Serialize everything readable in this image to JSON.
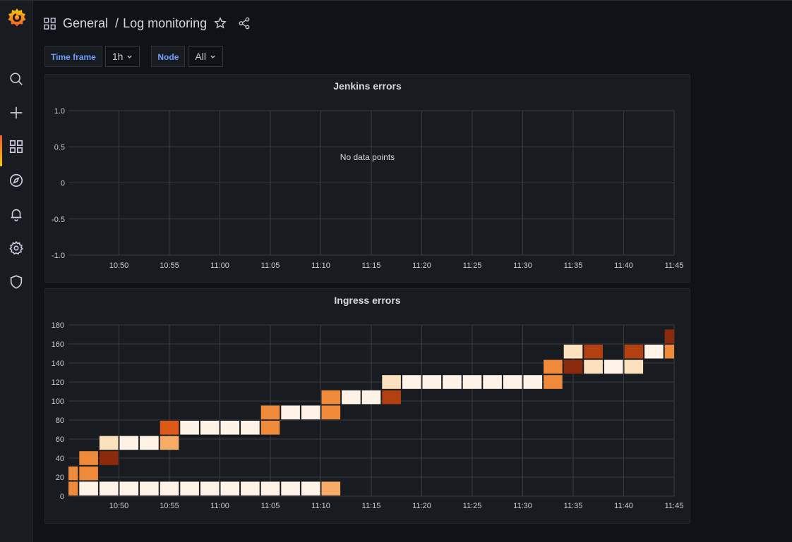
{
  "breadcrumb": {
    "folder": "General",
    "separator": "/",
    "dashboard": "Log monitoring"
  },
  "variables": [
    {
      "label": "Time frame",
      "value": "1h"
    },
    {
      "label": "Node",
      "value": "All"
    }
  ],
  "icons": [
    "grafana-logo-icon",
    "search-icon",
    "plus-icon",
    "dashboards-icon",
    "explore-icon",
    "alerting-icon",
    "settings-icon",
    "shield-icon",
    "star-icon",
    "share-icon",
    "chevron-down-icon"
  ],
  "colors": {
    "background": "#111217",
    "panel": "#181b1f",
    "accent": "#6e9fff",
    "brand": "#f05a28"
  },
  "panels": {
    "jenkins": {
      "title": "Jenkins errors",
      "no_data": "No data points"
    },
    "ingress": {
      "title": "Ingress errors"
    }
  },
  "chart_data": [
    {
      "type": "line",
      "title": "Jenkins errors",
      "x_ticks": [
        "10:50",
        "10:55",
        "11:00",
        "11:05",
        "11:10",
        "11:15",
        "11:20",
        "11:25",
        "11:30",
        "11:35",
        "11:40",
        "11:45"
      ],
      "y_ticks": [
        "1.0",
        "0.5",
        "0",
        "-0.5",
        "-1.0"
      ],
      "ylim": [
        -1,
        1
      ],
      "series": [],
      "grid": true
    },
    {
      "type": "heatmap",
      "title": "Ingress errors",
      "x_ticks": [
        "10:50",
        "10:55",
        "11:00",
        "11:05",
        "11:10",
        "11:15",
        "11:20",
        "11:25",
        "11:30",
        "11:35",
        "11:40",
        "11:45"
      ],
      "y_ticks": [
        "0",
        "20",
        "40",
        "60",
        "80",
        "100",
        "120",
        "140",
        "160",
        "180"
      ],
      "ylim": [
        0,
        180
      ],
      "xlim": [
        "10:45",
        "11:45"
      ],
      "bucket_minutes": 2,
      "bucket_size": 16,
      "grid": true,
      "color_scale": [
        "#fef3e6",
        "#fbe1bd",
        "#f6ab66",
        "#f08a3b",
        "#dd5918",
        "#b34010",
        "#8c2b0b"
      ],
      "cells": [
        {
          "t": "10:45",
          "y": 0,
          "c": 3
        },
        {
          "t": "10:45",
          "y": 16,
          "c": 3
        },
        {
          "t": "10:47",
          "y": 0,
          "c": 0
        },
        {
          "t": "10:47",
          "y": 16,
          "c": 3
        },
        {
          "t": "10:47",
          "y": 32,
          "c": 3
        },
        {
          "t": "10:49",
          "y": 0,
          "c": 0
        },
        {
          "t": "10:49",
          "y": 32,
          "c": 6
        },
        {
          "t": "10:49",
          "y": 48,
          "c": 1
        },
        {
          "t": "10:51",
          "y": 0,
          "c": 0
        },
        {
          "t": "10:51",
          "y": 48,
          "c": 0
        },
        {
          "t": "10:53",
          "y": 0,
          "c": 0
        },
        {
          "t": "10:53",
          "y": 48,
          "c": 0
        },
        {
          "t": "10:55",
          "y": 0,
          "c": 0
        },
        {
          "t": "10:55",
          "y": 48,
          "c": 2
        },
        {
          "t": "10:55",
          "y": 64,
          "c": 4
        },
        {
          "t": "10:57",
          "y": 0,
          "c": 0
        },
        {
          "t": "10:57",
          "y": 64,
          "c": 0
        },
        {
          "t": "10:59",
          "y": 0,
          "c": 0
        },
        {
          "t": "10:59",
          "y": 64,
          "c": 0
        },
        {
          "t": "11:01",
          "y": 0,
          "c": 0
        },
        {
          "t": "11:01",
          "y": 64,
          "c": 0
        },
        {
          "t": "11:03",
          "y": 0,
          "c": 0
        },
        {
          "t": "11:03",
          "y": 64,
          "c": 0
        },
        {
          "t": "11:05",
          "y": 0,
          "c": 0
        },
        {
          "t": "11:05",
          "y": 64,
          "c": 3
        },
        {
          "t": "11:05",
          "y": 80,
          "c": 3
        },
        {
          "t": "11:07",
          "y": 0,
          "c": 0
        },
        {
          "t": "11:07",
          "y": 80,
          "c": 0
        },
        {
          "t": "11:09",
          "y": 0,
          "c": 0
        },
        {
          "t": "11:09",
          "y": 80,
          "c": 0
        },
        {
          "t": "11:11",
          "y": 0,
          "c": 2
        },
        {
          "t": "11:11",
          "y": 80,
          "c": 3
        },
        {
          "t": "11:11",
          "y": 96,
          "c": 3
        },
        {
          "t": "11:13",
          "y": 96,
          "c": 0
        },
        {
          "t": "11:15",
          "y": 96,
          "c": 0
        },
        {
          "t": "11:17",
          "y": 96,
          "c": 5
        },
        {
          "t": "11:17",
          "y": 112,
          "c": 1
        },
        {
          "t": "11:19",
          "y": 112,
          "c": 0
        },
        {
          "t": "11:21",
          "y": 112,
          "c": 0
        },
        {
          "t": "11:23",
          "y": 112,
          "c": 0
        },
        {
          "t": "11:25",
          "y": 112,
          "c": 0
        },
        {
          "t": "11:27",
          "y": 112,
          "c": 0
        },
        {
          "t": "11:29",
          "y": 112,
          "c": 0
        },
        {
          "t": "11:31",
          "y": 112,
          "c": 0
        },
        {
          "t": "11:33",
          "y": 112,
          "c": 3
        },
        {
          "t": "11:33",
          "y": 128,
          "c": 3
        },
        {
          "t": "11:35",
          "y": 128,
          "c": 6
        },
        {
          "t": "11:35",
          "y": 144,
          "c": 1
        },
        {
          "t": "11:37",
          "y": 128,
          "c": 1
        },
        {
          "t": "11:37",
          "y": 144,
          "c": 5
        },
        {
          "t": "11:39",
          "y": 128,
          "c": 0
        },
        {
          "t": "11:41",
          "y": 128,
          "c": 1
        },
        {
          "t": "11:41",
          "y": 144,
          "c": 5
        },
        {
          "t": "11:43",
          "y": 144,
          "c": 0
        },
        {
          "t": "11:45",
          "y": 144,
          "c": 3
        },
        {
          "t": "11:45",
          "y": 160,
          "c": 6
        }
      ]
    }
  ]
}
